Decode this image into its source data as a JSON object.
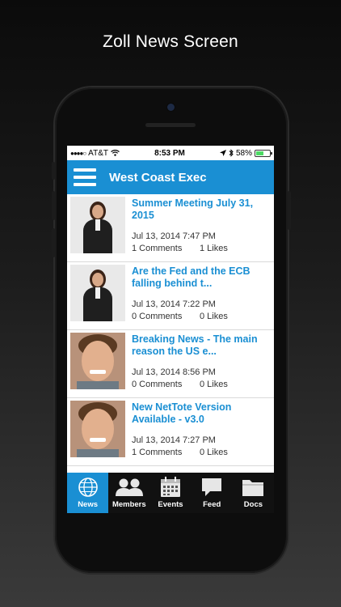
{
  "caption": "Zoll News Screen",
  "status_bar": {
    "carrier": "AT&T",
    "time": "8:53 PM",
    "battery_percent": "58%",
    "battery_level": 0.58
  },
  "header": {
    "title": "West Coast Exec"
  },
  "feed": [
    {
      "title": "Summer Meeting July 31, 2015",
      "date": "Jul 13, 2014 7:47 PM",
      "comments": "1 Comments",
      "likes": "1 Likes",
      "avatar": "woman-in-suit"
    },
    {
      "title": "Are the Fed and the ECB falling behind t...",
      "date": "Jul 13, 2014 7:22 PM",
      "comments": "0 Comments",
      "likes": "0 Likes",
      "avatar": "woman-in-suit"
    },
    {
      "title": "Breaking News - The main reason the US e...",
      "date": "Jul 13, 2014 8:56 PM",
      "comments": "0 Comments",
      "likes": "0 Likes",
      "avatar": "young-man"
    },
    {
      "title": "New NetTote Version Available - v3.0",
      "date": "Jul 13, 2014 7:27 PM",
      "comments": "1 Comments",
      "likes": "0 Likes",
      "avatar": "young-man"
    }
  ],
  "tabs": [
    {
      "label": "News",
      "icon": "globe-icon",
      "active": true
    },
    {
      "label": "Members",
      "icon": "people-icon",
      "active": false
    },
    {
      "label": "Events",
      "icon": "calendar-icon",
      "active": false
    },
    {
      "label": "Feed",
      "icon": "chat-bubble-icon",
      "active": false
    },
    {
      "label": "Docs",
      "icon": "folder-icon",
      "active": false
    }
  ],
  "colors": {
    "accent": "#1a8fd3",
    "tabbar": "#111111"
  }
}
